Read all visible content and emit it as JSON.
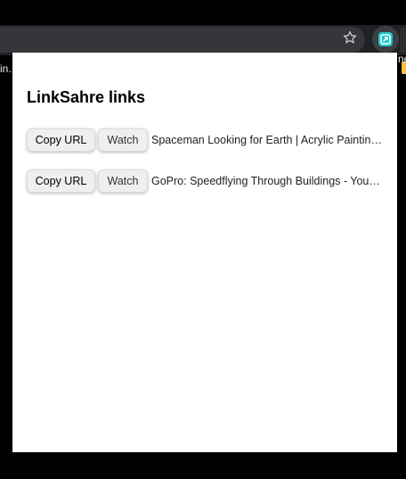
{
  "browser": {
    "bookmark_left_text": "in..",
    "bookmark_right_text": "ne"
  },
  "icons": {
    "bookmark_star": "star-icon",
    "extension": "linksahre-extension-icon",
    "bookmark_folder": "folder-icon"
  },
  "popup": {
    "title": "LinkSahre links",
    "links": [
      {
        "copy_label": "Copy URL",
        "watch_label": "Watch",
        "title": "Spaceman Looking for Earth | Acrylic Painting for Beginners"
      },
      {
        "copy_label": "Copy URL",
        "watch_label": "Watch",
        "title": "GoPro: Speedflying Through Buildings - YouTube"
      }
    ]
  },
  "colors": {
    "toolbar": "#202124",
    "omnibox": "#35363a",
    "extension_accent": "#1ec8c8",
    "popup_background": "#ffffff",
    "button_background": "#efefef"
  }
}
